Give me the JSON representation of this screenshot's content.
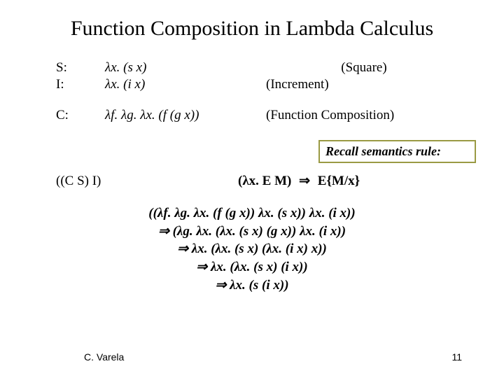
{
  "title": "Function Composition in Lambda Calculus",
  "defs": {
    "s_label": "S:",
    "s_expr": "λx. (s x)",
    "s_desc": "(Square)",
    "i_label": "I:",
    "i_expr": "λx. (i x)",
    "i_desc": "(Increment)",
    "c_label": "C:",
    "c_expr": "λf. λg. λx. (f (g x))",
    "c_desc": "(Function Composition)"
  },
  "callout": "Recall semantics rule:",
  "rule": {
    "lhs": "((C S) I)",
    "rhs_l": "(λx. E M)",
    "rhs_arrow": "⇒",
    "rhs_r": "E{M/x}"
  },
  "deriv": {
    "l1": "((λf. λg. λx. (f (g x)) λx. (s x)) λx. (i x))",
    "l2": "⇒ (λg. λx. (λx. (s x) (g x)) λx. (i x))",
    "l3": "⇒ λx. (λx. (s x) (λx. (i x) x))",
    "l4": "⇒ λx. (λx. (s x) (i x))",
    "l5": "⇒ λx. (s (i x))"
  },
  "footer": {
    "author": "C. Varela",
    "page": "11"
  }
}
